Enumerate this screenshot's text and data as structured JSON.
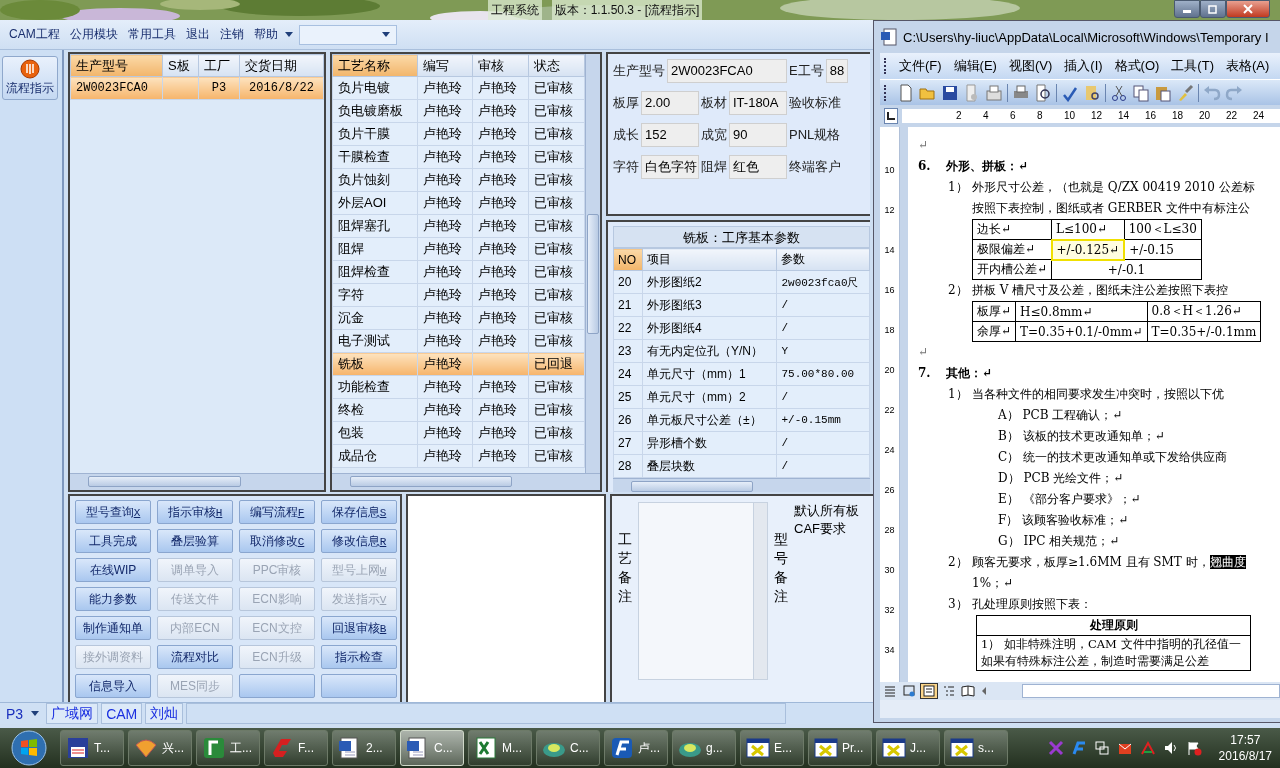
{
  "app": {
    "title": "工程系统",
    "version": "版本：1.1.50.3 - [流程指示]"
  },
  "menu": [
    {
      "label": "CAM工程"
    },
    {
      "label": "公用模块"
    },
    {
      "label": "常用工具"
    },
    {
      "label": "退出"
    },
    {
      "label": "注销"
    },
    {
      "label": "帮助"
    }
  ],
  "sidebar": {
    "button": "流程指示"
  },
  "orders": {
    "columns": [
      "生产型号",
      "S板",
      "工厂",
      "交货日期"
    ],
    "rows": [
      {
        "model": "2W0023FCA0",
        "factory": "P3",
        "date": "2016/8/22",
        "selected": true
      }
    ]
  },
  "process": {
    "columns": [
      "工艺名称",
      "编写",
      "审核",
      "状态"
    ],
    "rows": [
      {
        "name": "负片电镀",
        "writer": "卢艳玲",
        "reviewer": "卢艳玲",
        "status": "已审核",
        "selected": false
      },
      {
        "name": "负电镀磨板",
        "writer": "卢艳玲",
        "reviewer": "卢艳玲",
        "status": "已审核",
        "selected": false
      },
      {
        "name": "负片干膜",
        "writer": "卢艳玲",
        "reviewer": "卢艳玲",
        "status": "已审核",
        "selected": false
      },
      {
        "name": "干膜检查",
        "writer": "卢艳玲",
        "reviewer": "卢艳玲",
        "status": "已审核",
        "selected": false
      },
      {
        "name": "负片蚀刻",
        "writer": "卢艳玲",
        "reviewer": "卢艳玲",
        "status": "已审核",
        "selected": false
      },
      {
        "name": "外层AOI",
        "writer": "卢艳玲",
        "reviewer": "卢艳玲",
        "status": "已审核",
        "selected": false
      },
      {
        "name": "阻焊塞孔",
        "writer": "卢艳玲",
        "reviewer": "卢艳玲",
        "status": "已审核",
        "selected": false
      },
      {
        "name": "阻焊",
        "writer": "卢艳玲",
        "reviewer": "卢艳玲",
        "status": "已审核",
        "selected": false
      },
      {
        "name": "阻焊检查",
        "writer": "卢艳玲",
        "reviewer": "卢艳玲",
        "status": "已审核",
        "selected": false
      },
      {
        "name": "字符",
        "writer": "卢艳玲",
        "reviewer": "卢艳玲",
        "status": "已审核",
        "selected": false
      },
      {
        "name": "沉金",
        "writer": "卢艳玲",
        "reviewer": "卢艳玲",
        "status": "已审核",
        "selected": false
      },
      {
        "name": "电子测试",
        "writer": "卢艳玲",
        "reviewer": "卢艳玲",
        "status": "已审核",
        "selected": false
      },
      {
        "name": "铣板",
        "writer": "卢艳玲",
        "status": "已回退",
        "selected": true
      },
      {
        "name": "功能检查",
        "writer": "卢艳玲",
        "reviewer": "卢艳玲",
        "status": "已审核",
        "selected": false
      },
      {
        "name": "终检",
        "writer": "卢艳玲",
        "reviewer": "卢艳玲",
        "status": "已审核",
        "selected": false
      },
      {
        "name": "包装",
        "writer": "卢艳玲",
        "reviewer": "卢艳玲",
        "status": "已审核",
        "selected": false
      },
      {
        "name": "成品仓",
        "writer": "卢艳玲",
        "reviewer": "卢艳玲",
        "status": "已审核",
        "selected": false
      }
    ]
  },
  "form": {
    "fields": [
      {
        "label": "生产型号",
        "value": "2W0023FCA0",
        "kind": "wide"
      },
      {
        "label": "E工号",
        "value": "88",
        "kind": "normal"
      },
      {
        "label": "板厚",
        "value": "2.00",
        "kind": "normal"
      },
      {
        "label": "板材",
        "value": "IT-180A",
        "kind": "normal"
      },
      {
        "label": "验收标准",
        "kind": "normal"
      },
      {
        "label": "成长",
        "value": "152",
        "kind": "normal"
      },
      {
        "label": "成宽",
        "value": "90",
        "kind": "normal"
      },
      {
        "label": "PNL规格",
        "kind": "normal"
      },
      {
        "label": "字符",
        "value": "白色字符",
        "kind": "normal"
      },
      {
        "label": "阻焊",
        "value": "红色",
        "kind": "normal"
      },
      {
        "label": "终端客户",
        "kind": "normal"
      }
    ]
  },
  "params": {
    "title": "铣板：工序基本参数",
    "columns": [
      "NO",
      "项目",
      "参数"
    ],
    "rows": [
      {
        "no": "20",
        "item": "外形图纸2",
        "value": "2w0023fca0尺"
      },
      {
        "no": "21",
        "item": "外形图纸3",
        "value": "/"
      },
      {
        "no": "22",
        "item": "外形图纸4",
        "value": "/"
      },
      {
        "no": "23",
        "item": "有无内定位孔（Y/N）",
        "value": "Y"
      },
      {
        "no": "24",
        "item": "单元尺寸（mm）1",
        "value": "75.00*80.00"
      },
      {
        "no": "25",
        "item": "单元尺寸（mm）2",
        "value": "/"
      },
      {
        "no": "26",
        "item": "单元板尺寸公差（±）",
        "value": "+/-0.15mm"
      },
      {
        "no": "27",
        "item": "异形槽个数",
        "value": "/"
      },
      {
        "no": "28",
        "item": "叠层块数",
        "value": "/"
      }
    ]
  },
  "buttons": [
    {
      "label": "型号查询",
      "hotkey": "X",
      "disabled": false
    },
    {
      "label": "指示审核",
      "hotkey": "H",
      "disabled": false
    },
    {
      "label": "编写流程",
      "hotkey": "F",
      "disabled": false
    },
    {
      "label": "保存信息",
      "hotkey": "S",
      "disabled": false
    },
    {
      "label": "工具完成",
      "disabled": false
    },
    {
      "label": "叠层验算",
      "disabled": false
    },
    {
      "label": "取消修改",
      "hotkey": "C",
      "disabled": false
    },
    {
      "label": "修改信息",
      "hotkey": "R",
      "disabled": false
    },
    {
      "label": "在线WIP",
      "disabled": false
    },
    {
      "label": "调单导入",
      "disabled": true
    },
    {
      "label": "PPC审核",
      "disabled": true
    },
    {
      "label": "型号上网",
      "hotkey": "W",
      "disabled": true
    },
    {
      "label": "能力参数",
      "disabled": false
    },
    {
      "label": "传送文件",
      "disabled": true
    },
    {
      "label": "ECN影响",
      "disabled": true
    },
    {
      "label": "发送指示",
      "hotkey": "V",
      "disabled": true
    },
    {
      "label": "制作通知单",
      "disabled": false
    },
    {
      "label": "内部ECN",
      "disabled": true
    },
    {
      "label": "ECN文控",
      "disabled": true
    },
    {
      "label": "回退审核",
      "hotkey": "B",
      "disabled": false
    },
    {
      "label": "接外调资料",
      "disabled": true
    },
    {
      "label": "流程对比",
      "disabled": false
    },
    {
      "label": "ECN升级",
      "disabled": true
    },
    {
      "label": "指示检查",
      "disabled": false
    },
    {
      "label": "信息导入",
      "disabled": false
    },
    {
      "label": "MES同步",
      "disabled": true
    },
    {
      "disabled": false
    },
    {
      "disabled": false
    }
  ],
  "remarks": {
    "process_label": "工艺备注",
    "model_label": "型号备注",
    "model_lines": [
      "默认所有板",
      "CAF要求"
    ]
  },
  "status_bar": {
    "factory": "P3",
    "items": [
      "广域网",
      "CAM",
      "刘灿"
    ]
  },
  "word": {
    "title": "C:\\Users\\hy-liuc\\AppData\\Local\\Microsoft\\Windows\\Temporary I",
    "menu": [
      "文件(F)",
      "编辑(E)",
      "视图(V)",
      "插入(I)",
      "格式(O)",
      "工具(T)",
      "表格(A)"
    ],
    "ruler": [
      "2",
      "4",
      "6",
      "8",
      "10",
      "12",
      "14",
      "16",
      "18",
      "20",
      "22",
      "24"
    ],
    "vruler": [
      "10",
      "12",
      "14",
      "16",
      "18",
      "20",
      "22",
      "24",
      "26",
      "28",
      "30",
      "32",
      "34"
    ],
    "blocks": [
      {
        "kind": "blank",
        "text": "↵"
      },
      {
        "kind": "heading",
        "num": "6.",
        "text": "外形、拼板：↵"
      },
      {
        "kind": "item",
        "num": "1）",
        "text": "外形尺寸公差，（也就是 Q/ZX 00419 2010 公差标"
      },
      {
        "kind": "cont",
        "text": "按照下表控制，图纸或者 GERBER 文件中有标注公"
      },
      {
        "kind": "table",
        "rows": [
          [
            {
              "text": "边长↵",
              "highlighted": false
            },
            {
              "text": "L≤100↵",
              "highlighted": false
            },
            {
              "text": "100＜L≤30",
              "highlighted": false
            }
          ],
          [
            {
              "text": "极限偏差↵",
              "highlighted": false
            },
            {
              "text": "+/-0.125↵",
              "highlighted": true
            },
            {
              "text": "+/-0.15",
              "highlighted": false
            }
          ],
          [
            {
              "text": "开内槽公差↵",
              "highlighted": false
            },
            {
              "text": "+/-0.1",
              "highlighted": false,
              "colspan": 2
            }
          ]
        ]
      },
      {
        "kind": "item",
        "num": "2）",
        "text": "拼板 V 槽尺寸及公差，图纸未注公差按照下表控"
      },
      {
        "kind": "table",
        "rows": [
          [
            {
              "text": "板厚↵",
              "highlighted": false
            },
            {
              "text": "H≤0.8mm↵",
              "highlighted": false
            },
            {
              "text": "0.8＜H＜1.26↵",
              "highlighted": false
            }
          ],
          [
            {
              "text": "余厚↵",
              "highlighted": false
            },
            {
              "text": "T=0.35+0.1/-0mm↵",
              "highlighted": false
            },
            {
              "text": "T=0.35+/-0.1mm",
              "highlighted": false
            }
          ]
        ]
      },
      {
        "kind": "blank",
        "text": "↵"
      },
      {
        "kind": "heading",
        "num": "7.",
        "text": "其他：↵"
      },
      {
        "kind": "item",
        "num": "1）",
        "text": "当各种文件的相同要求发生冲突时，按照以下优"
      },
      {
        "kind": "sub",
        "text": "A） PCB 工程确认；↵"
      },
      {
        "kind": "sub",
        "text": "B） 该板的技术更改通知单；↵"
      },
      {
        "kind": "sub",
        "text": "C） 统一的技术更改通知单或下发给供应商"
      },
      {
        "kind": "sub",
        "text": "D） PCB 光绘文件；↵"
      },
      {
        "kind": "sub",
        "text": "E） 《部分客户要求》；↵"
      },
      {
        "kind": "sub",
        "text": "F） 该顾客验收标准；↵"
      },
      {
        "kind": "sub",
        "text": "G） IPC 相关规范；↵"
      },
      {
        "kind": "item",
        "num": "2）",
        "text": "顾客无要求，板厚≥1.6MM 且有 SMT 时，",
        "selection": "翘曲度"
      },
      {
        "kind": "cont",
        "text": "1%；↵"
      },
      {
        "kind": "item",
        "num": "3）",
        "text": "孔处理原则按照下表："
      },
      {
        "kind": "table",
        "rows": [
          [
            {
              "text": "处理原则",
              "highlighted": false
            }
          ],
          [
            {
              "text": "1） 如非特殊注明，CAM 文件中指明的孔径值一如果有特殊标注公差，制造时需要满足公差",
              "highlighted": false
            }
          ]
        ]
      }
    ]
  },
  "taskbar": {
    "items": [
      {
        "label": "T...",
        "selected": false
      },
      {
        "label": "兴...",
        "selected": false
      },
      {
        "label": "工...",
        "selected": false
      },
      {
        "label": "F...",
        "selected": false
      },
      {
        "label": "2...",
        "selected": false
      },
      {
        "label": "C...",
        "selected": true
      },
      {
        "label": "M...",
        "selected": false
      },
      {
        "label": "C...",
        "selected": false
      },
      {
        "label": "卢...",
        "selected": false
      },
      {
        "label": "g...",
        "selected": false
      },
      {
        "label": "E...",
        "selected": false
      },
      {
        "label": "Pr...",
        "selected": false
      },
      {
        "label": "J...",
        "selected": false
      },
      {
        "label": "s...",
        "selected": false
      }
    ],
    "time": "17:57",
    "date": "2016/8/17"
  }
}
